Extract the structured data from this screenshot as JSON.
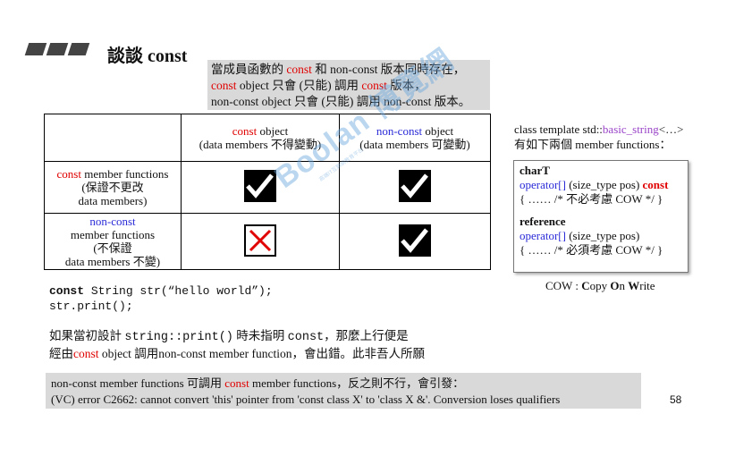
{
  "header": {
    "title": "談談 const"
  },
  "callout": {
    "line1_a": "當成員函數的 ",
    "line1_b": "const",
    "line1_c": " 和 non-const 版本同時存在，",
    "line2_a": "const",
    "line2_b": " object 只會 (只能) 調用 ",
    "line2_c": "const",
    "line2_d": " 版本，",
    "line3": "non-const object 只會 (只能) 調用 non-const 版本。"
  },
  "table": {
    "col1_red": "const",
    "col1_rest": " object",
    "col1_sub": "(data members 不得變動)",
    "col2_blue": "non-const",
    "col2_rest": " object",
    "col2_sub": "(data members 可變動)",
    "row1_red": "const",
    "row1_rest": " member functions",
    "row1_l2": "(保證不更改",
    "row1_l3": "data members)",
    "row2_blue": "non-const",
    "row2_l2": "member functions",
    "row2_l3": "(不保證",
    "row2_l4": "data members 不變)",
    "cells": [
      "check",
      "check",
      "cross",
      "check"
    ]
  },
  "code": {
    "line1_kw": "const",
    "line1_rest": " String str(“hello world”);",
    "line2": "str.print();"
  },
  "paragraph": {
    "line1_a": "如果當初設計 ",
    "line1_mono": "string::print()",
    "line1_b": " 時未指明 ",
    "line1_mono2": "const",
    "line1_c": "，那麼上行便是",
    "line2_a": "經由",
    "line2_red": "const",
    "line2_b": " object 調用non-const member function，會出錯。此非吾人所願"
  },
  "bottom": {
    "line1_a": "non-const member functions 可調用 ",
    "line1_red": "const",
    "line1_b": " member functions，反之則不行，會引發：",
    "line2": "(VC) error C2662: cannot convert 'this' pointer from 'const class X' to 'class X &'.  Conversion loses qualifiers"
  },
  "page_number": "58",
  "right": {
    "tmpl_a": "class template std::",
    "tmpl_purple": "basic_string",
    "tmpl_b": "<…>",
    "tmpl_line2": "有如下兩個 member functions：",
    "m1_type": "charT",
    "m1_op": "operator[]",
    "m1_args": " (size_type pos) ",
    "m1_const": "const",
    "m1_body": "{ …… /* 不必考慮 COW */  }",
    "m2_type": "reference",
    "m2_op": "operator[]",
    "m2_args": " (size_type pos)",
    "m2_body": "{ …… /* 必須考慮 COW */  }",
    "cow_a": "COW : ",
    "cow_C": "C",
    "cow_b": "opy ",
    "cow_O": "O",
    "cow_c": "n ",
    "cow_W": "W",
    "cow_d": "rite"
  },
  "watermark": {
    "main": "Boolan 博覽網",
    "sub": "高端IT互聯網教育平台"
  },
  "colors": {
    "red": "#e00000",
    "blue": "#2a2ad8",
    "purple": "#9a44c8",
    "callout_bg": "#d9d9d9"
  }
}
